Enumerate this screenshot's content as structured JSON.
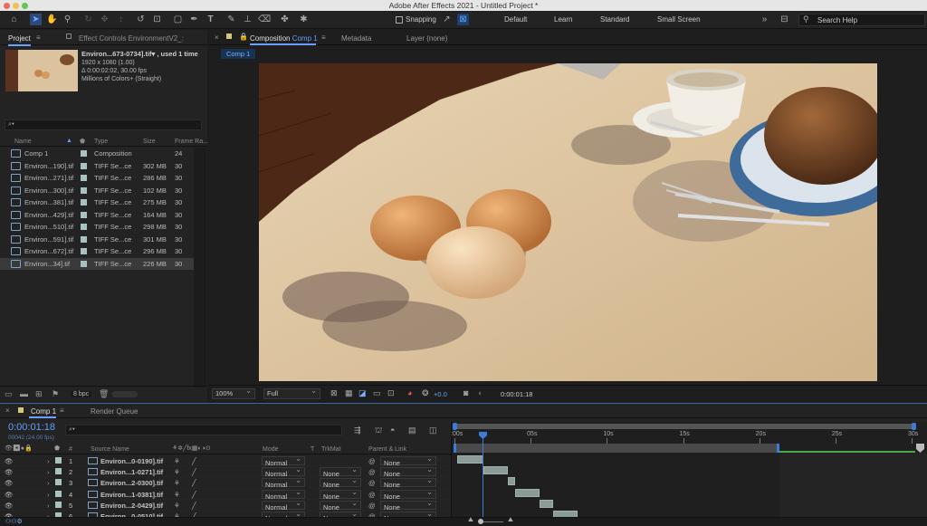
{
  "app": {
    "window_title": "Adobe After Effects 2021 - Untitled Project *"
  },
  "toolbar": {
    "snapping_label": "Snapping",
    "workspaces": [
      "Default",
      "Learn",
      "Standard",
      "Small Screen"
    ],
    "search_help_placeholder": "Search Help"
  },
  "project_panel": {
    "tab_label": "Project",
    "effect_controls_tab": "Effect Controls EnvironmentV2_:",
    "preview": {
      "name_line": "Environ...673-0734].tif▾ , used 1 time",
      "dims": "1920 x 1080 (1.00)",
      "duration": "Δ 0:00:02:02, 30.00 fps",
      "colors": "Millions of Colors+ (Straight)"
    },
    "search_placeholder": "⌕▾",
    "columns": {
      "name": "Name",
      "type": "Type",
      "size": "Size",
      "frame_rate": "Frame Ra..."
    },
    "items": [
      {
        "name": "Comp 1",
        "type": "Composition",
        "size": "",
        "fps": "24"
      },
      {
        "name": "Environ...190].tif",
        "type": "TIFF Se...ce",
        "size": "302 MB",
        "fps": "30"
      },
      {
        "name": "Environ...271].tif",
        "type": "TIFF Se...ce",
        "size": "286 MB",
        "fps": "30"
      },
      {
        "name": "Environ...300].tif",
        "type": "TIFF Se...ce",
        "size": "102 MB",
        "fps": "30"
      },
      {
        "name": "Environ...381].tif",
        "type": "TIFF Se...ce",
        "size": "275 MB",
        "fps": "30"
      },
      {
        "name": "Environ...429].tif",
        "type": "TIFF Se...ce",
        "size": "164 MB",
        "fps": "30"
      },
      {
        "name": "Environ...510].tif",
        "type": "TIFF Se...ce",
        "size": "298 MB",
        "fps": "30"
      },
      {
        "name": "Environ...591].tif",
        "type": "TIFF Se...ce",
        "size": "301 MB",
        "fps": "30"
      },
      {
        "name": "Environ...672].tif",
        "type": "TIFF Se...ce",
        "size": "296 MB",
        "fps": "30"
      },
      {
        "name": "Environ...34].tif",
        "type": "TIFF Se...ce",
        "size": "226 MB",
        "fps": "30"
      }
    ],
    "bpc_label": "8 bpc"
  },
  "composition_panel": {
    "tab_prefix": "Composition",
    "tab_comp": "Comp 1",
    "metadata_tab": "Metadata",
    "layer_tab": "Layer (none)",
    "comp_chip": "Comp 1",
    "zoom": "100%",
    "resolution": "Full",
    "exposure": "+0.0",
    "timecode": "0:00:01:18"
  },
  "timeline_panel": {
    "tab_label": "Comp 1",
    "render_queue_tab": "Render Queue",
    "current_time": "0:00:01:18",
    "frame_info": "00042 (24.00 fps)",
    "search_placeholder": "⌕▾",
    "columns": {
      "num": "#",
      "source_name": "Source Name",
      "mode": "Mode",
      "t": "T",
      "trkmat": "TrkMat",
      "parent": "Parent & Link"
    },
    "ruler_labels": [
      ":00s",
      "05s",
      "10s",
      "15s",
      "20s",
      "25s",
      "30s"
    ],
    "layers": [
      {
        "num": "1",
        "name": "Environ...0-0190].tif",
        "mode": "Normal",
        "trkmat": "",
        "parent": "None",
        "start": 0.15,
        "end": 1.9
      },
      {
        "num": "2",
        "name": "Environ...1-0271].tif",
        "mode": "Normal",
        "trkmat": "None",
        "parent": "None",
        "start": 1.9,
        "end": 3.5
      },
      {
        "num": "3",
        "name": "Environ...2-0300].tif",
        "mode": "Normal",
        "trkmat": "None",
        "parent": "None",
        "start": 3.5,
        "end": 4.0
      },
      {
        "num": "4",
        "name": "Environ...1-0381].tif",
        "mode": "Normal",
        "trkmat": "None",
        "parent": "None",
        "start": 4.0,
        "end": 5.6
      },
      {
        "num": "5",
        "name": "Environ...2-0429].tif",
        "mode": "Normal",
        "trkmat": "None",
        "parent": "None",
        "start": 5.6,
        "end": 6.5
      },
      {
        "num": "6",
        "name": "Environ...0-0510].tif",
        "mode": "Normal",
        "trkmat": "None",
        "parent": "None",
        "start": 6.5,
        "end": 8.1
      }
    ]
  }
}
